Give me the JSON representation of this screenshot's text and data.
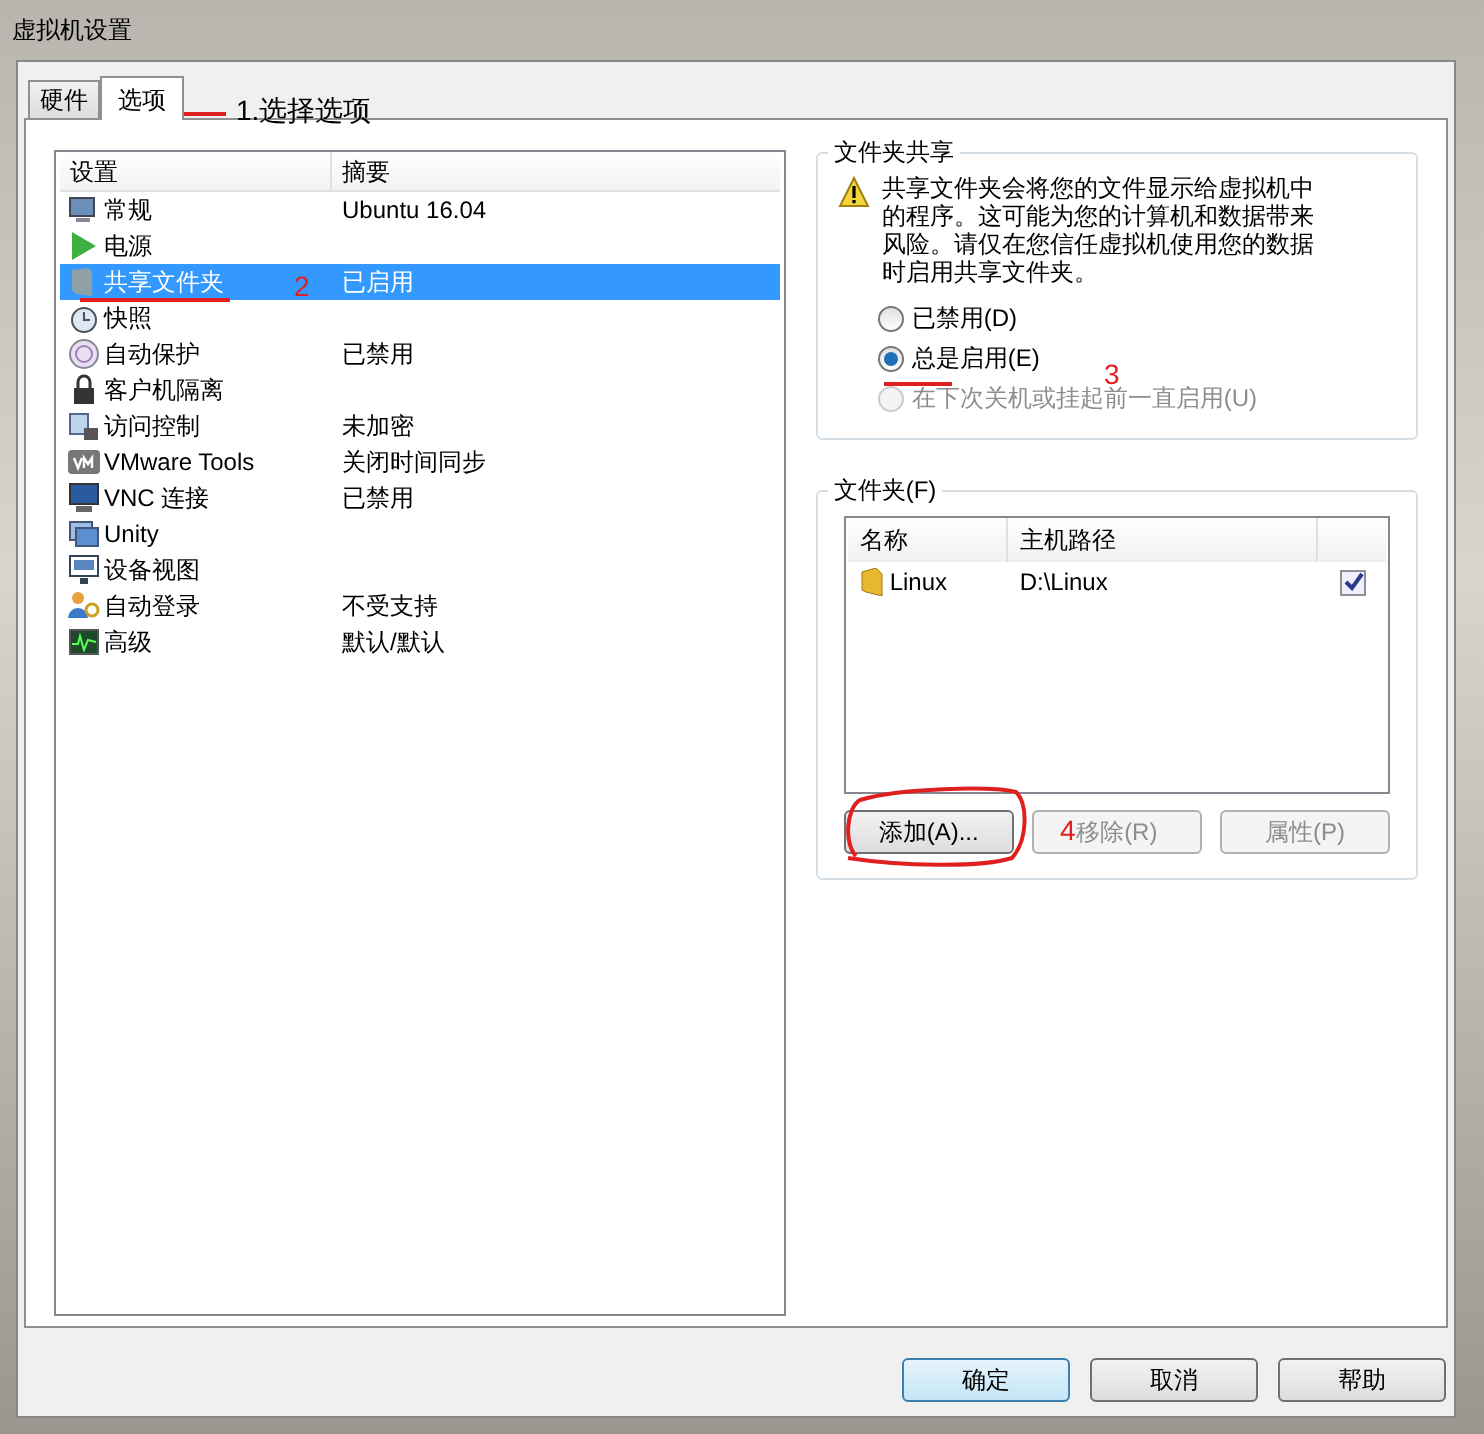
{
  "window": {
    "title": "虚拟机设置"
  },
  "tabs": [
    {
      "label": "硬件",
      "selected": false
    },
    {
      "label": "选项",
      "selected": true
    }
  ],
  "settings_list": {
    "columns": [
      "设置",
      "摘要"
    ],
    "rows": [
      {
        "name": "常规",
        "summary": "Ubuntu 16.04",
        "selected": false
      },
      {
        "name": "电源",
        "selected": false
      },
      {
        "name": "共享文件夹",
        "summary": "已启用",
        "selected": true
      },
      {
        "name": "快照",
        "selected": false
      },
      {
        "name": "自动保护",
        "summary": "已禁用",
        "selected": false
      },
      {
        "name": "客户机隔离",
        "selected": false
      },
      {
        "name": "访问控制",
        "summary": "未加密",
        "selected": false
      },
      {
        "name": "VMware Tools",
        "summary": "关闭时间同步",
        "selected": false
      },
      {
        "name": "VNC 连接",
        "summary": "已禁用",
        "selected": false
      },
      {
        "name": "Unity",
        "selected": false
      },
      {
        "name": "设备视图",
        "selected": false
      },
      {
        "name": "自动登录",
        "summary": "不受支持",
        "selected": false
      },
      {
        "name": "高级",
        "summary": "默认/默认",
        "selected": false
      }
    ]
  },
  "folder_sharing": {
    "title": "文件夹共享",
    "warning": "共享文件夹会将您的文件显示给虚拟机中的程序。这可能为您的计算机和数据带来风险。请仅在您信任虚拟机使用您的数据时启用共享文件夹。",
    "options": [
      {
        "label": "已禁用(D)",
        "selected": false,
        "disabled": false
      },
      {
        "label": "总是启用(E)",
        "selected": true,
        "disabled": false
      },
      {
        "label": "在下次关机或挂起前一直启用(U)",
        "selected": false,
        "disabled": true
      }
    ]
  },
  "folders": {
    "title": "文件夹(F)",
    "columns": [
      "名称",
      "主机路径"
    ],
    "rows": [
      {
        "name": "Linux",
        "path": "D:\\Linux",
        "checked": true
      }
    ],
    "buttons": [
      {
        "label": "添加(A)...",
        "disabled": false
      },
      {
        "label": "移除(R)",
        "disabled": true
      },
      {
        "label": "属性(P)",
        "disabled": true
      }
    ]
  },
  "dialog_buttons": [
    {
      "label": "确定",
      "default": true
    },
    {
      "label": "取消",
      "default": false
    },
    {
      "label": "帮助",
      "default": false
    }
  ],
  "annotations": {
    "tab_note": "1.选择选项",
    "marker_2": "2",
    "marker_3": "3",
    "marker_4": "4"
  }
}
